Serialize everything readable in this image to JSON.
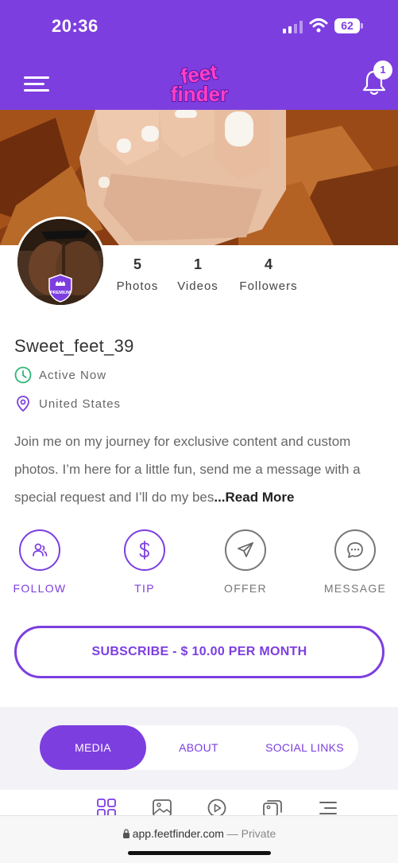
{
  "status_bar": {
    "time": "20:36",
    "battery": "62"
  },
  "header": {
    "logo_text_1": "feet",
    "logo_text_2": "finder",
    "notification_count": "1"
  },
  "profile": {
    "premium_badge": "PREMIUM",
    "stats": [
      {
        "value": "5",
        "label": "Photos"
      },
      {
        "value": "1",
        "label": "Videos"
      },
      {
        "value": "4",
        "label": "Followers"
      }
    ],
    "username": "Sweet_feet_39",
    "status": "Active Now",
    "location": "United States",
    "bio": "Join me on my journey for exclusive content and custom photos. I’m here for a little fun, send me a message with a special request and I’ll do my bes",
    "read_more": "...Read More"
  },
  "actions": [
    {
      "label": "FOLLOW",
      "icon": "follow-user-icon"
    },
    {
      "label": "TIP",
      "icon": "dollar-icon"
    },
    {
      "label": "OFFER",
      "icon": "paper-plane-icon"
    },
    {
      "label": "MESSAGE",
      "icon": "chat-bubble-icon"
    }
  ],
  "subscribe_label": "SUBSCRIBE - $ 10.00 PER MONTH",
  "tabs": [
    {
      "label": "MEDIA",
      "active": true
    },
    {
      "label": "ABOUT",
      "active": false
    },
    {
      "label": "SOCIAL LINKS",
      "active": false
    }
  ],
  "media_filter_icons": [
    "grid-icon",
    "image-icon",
    "play-icon",
    "gallery-icon",
    "list-icon"
  ],
  "browser": {
    "url": "app.feetfinder.com",
    "mode": "— Private"
  },
  "colors": {
    "brand_purple": "#7d3ee0",
    "active_green": "#2bb673",
    "gray": "#777777"
  }
}
